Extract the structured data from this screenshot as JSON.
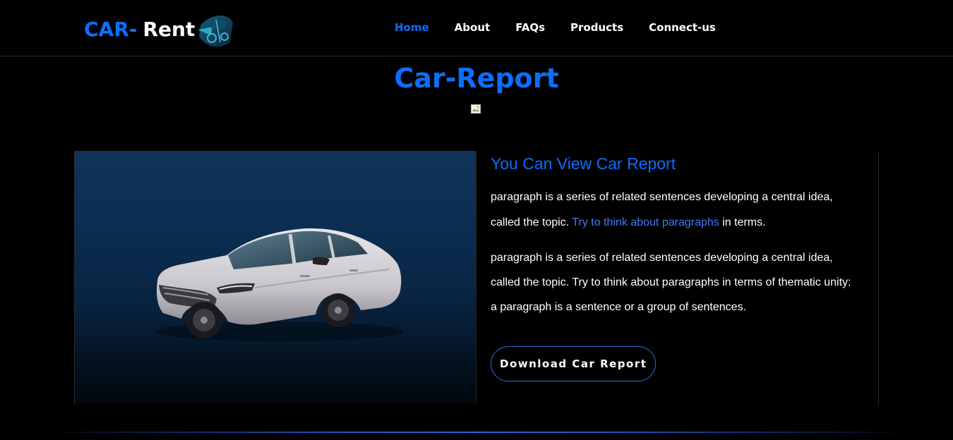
{
  "brand": {
    "part1": "CAR-",
    "part2": "Rent",
    "logo_icon": "car-logo-icon"
  },
  "nav": {
    "items": [
      {
        "label": "Home",
        "active": true
      },
      {
        "label": "About",
        "active": false
      },
      {
        "label": "FAQs",
        "active": false
      },
      {
        "label": "Products",
        "active": false
      },
      {
        "label": "Connect-us",
        "active": false
      }
    ]
  },
  "page": {
    "title": "Car-Report",
    "broken_image_icon": "broken-image-icon"
  },
  "report": {
    "car_image_icon": "sedan-car-image",
    "heading": "You Can View Car Report",
    "para1_before": "paragraph is a series of related sentences developing a central idea, called the topic. ",
    "para1_link": "Try to think about paragraphs",
    "para1_after": " in terms.",
    "para2": "paragraph is a series of related sentences developing a central idea, called the topic. Try to think about paragraphs in terms of thematic unity: a paragraph is a sentence or a group of sentences.",
    "download_label": "Download Car Report"
  },
  "colors": {
    "accent": "#0d6efd",
    "link": "#3d7bf5",
    "background": "#000000",
    "text": "#ffffff"
  }
}
